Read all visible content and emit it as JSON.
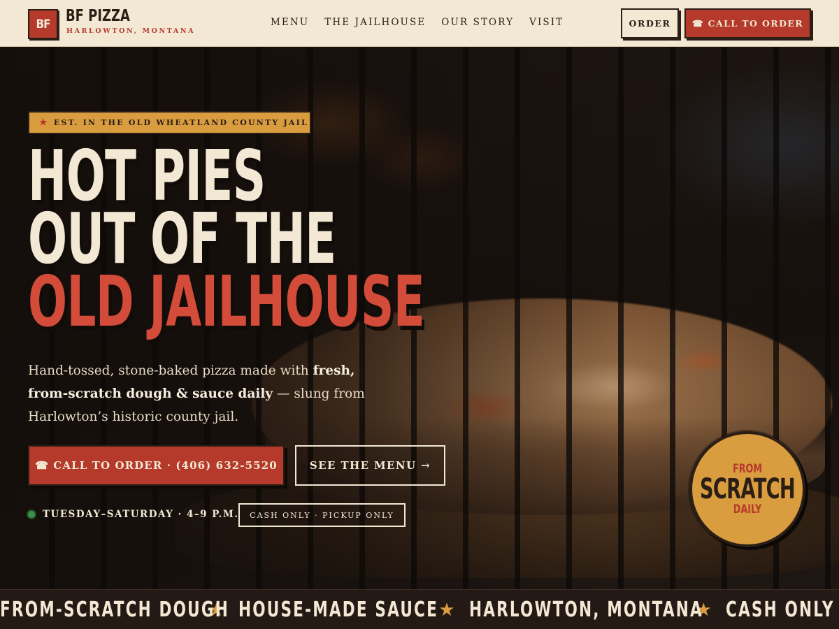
{
  "header": {
    "logo_initials": "BF",
    "brand_name": "BF PIZZA",
    "brand_location": "HARLOWTON, MONTANA",
    "nav": [
      "MENU",
      "THE JAILHOUSE",
      "OUR STORY",
      "VISIT"
    ],
    "order_label": "ORDER",
    "call_label": "☎ CALL TO ORDER"
  },
  "hero": {
    "badge_star": "★",
    "badge_text": "EST. IN THE OLD WHEATLAND COUNTY JAIL",
    "headline_line1": "HOT PIES",
    "headline_line2": "OUT OF THE",
    "headline_line3": "OLD JAILHOUSE",
    "sub_part1": "Hand-tossed, stone-baked pizza made with ",
    "sub_bold": "fresh, from-scratch dough & sauce daily",
    "sub_part2": " — slung from Harlowton’s historic county jail.",
    "cta_call": "☎ CALL TO ORDER · (406) 632-5520",
    "cta_menu": "SEE THE MENU →",
    "hours": "TUESDAY–SATURDAY · 4–9 P.M.",
    "cash_tag": "CASH ONLY · PICKUP ONLY",
    "seal_top": "FROM",
    "seal_mid": "SCRATCH",
    "seal_bot": "DAILY"
  },
  "ticker": {
    "items": [
      "FROM-SCRATCH DOUGH",
      "HOUSE-MADE SAUCE",
      "HARLOWTON, MONTANA",
      "CASH ONLY · PICKUP ONLY"
    ],
    "separator": "★"
  },
  "colors": {
    "cream": "#f3e8d4",
    "brick_red": "#b53a2b",
    "headline_red": "#d34b39",
    "mustard": "#d99c3e",
    "dark_brown": "#2a1e16",
    "status_green": "#3f8f4b"
  }
}
